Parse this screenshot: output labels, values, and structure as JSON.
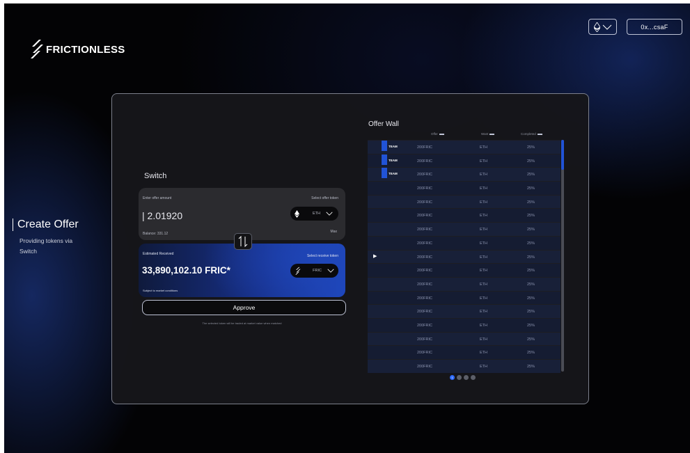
{
  "brand": {
    "name": "FRICTIONLESS"
  },
  "header": {
    "network_icon": "ethereum-icon",
    "wallet_address": "0x...csaF"
  },
  "sidebar": {
    "title": "Create Offer",
    "subtitle": "Providing tokens via Switch"
  },
  "switch": {
    "title": "Switch",
    "offer": {
      "label": "Enter offer amount",
      "select_label": "Select offer token",
      "amount": "| 2.01920",
      "balance": "Balance: 331.12",
      "max_label": "Max",
      "token": "ETH",
      "token_icon": "ethereum-icon"
    },
    "receive": {
      "label": "Estimated Received",
      "select_label": "Select receive token",
      "amount": "33,890,102.10 FRIC*",
      "note": "Subject to market conditions",
      "token": "FRIC",
      "token_icon": "frictionless-icon"
    },
    "approve_label": "Approve",
    "footnote": "The selected token will be traded at market value when matched"
  },
  "offer_wall": {
    "title": "Offer Wall",
    "columns": [
      "Offer",
      "Want",
      "Completed"
    ],
    "rows": [
      {
        "team": "TEAM",
        "offer": "200FRIC",
        "want": "ETH",
        "completed": "25%"
      },
      {
        "team": "TEAM",
        "offer": "200FRIC",
        "want": "ETH",
        "completed": "25%"
      },
      {
        "team": "TEAM",
        "offer": "200FRIC",
        "want": "ETH",
        "completed": "25%"
      },
      {
        "team": "",
        "offer": "200FRIC",
        "want": "ETH",
        "completed": "25%"
      },
      {
        "team": "",
        "offer": "200FRIC",
        "want": "ETH",
        "completed": "25%"
      },
      {
        "team": "",
        "offer": "200FRIC",
        "want": "ETH",
        "completed": "25%"
      },
      {
        "team": "",
        "offer": "200FRIC",
        "want": "ETH",
        "completed": "25%"
      },
      {
        "team": "",
        "offer": "200FRIC",
        "want": "ETH",
        "completed": "25%"
      },
      {
        "team": "",
        "offer": "200FRIC",
        "want": "ETH",
        "completed": "25%",
        "selected": true
      },
      {
        "team": "",
        "offer": "200FRIC",
        "want": "ETH",
        "completed": "25%"
      },
      {
        "team": "",
        "offer": "200FRIC",
        "want": "ETH",
        "completed": "25%"
      },
      {
        "team": "",
        "offer": "200FRIC",
        "want": "ETH",
        "completed": "25%"
      },
      {
        "team": "",
        "offer": "200FRIC",
        "want": "ETH",
        "completed": "25%"
      },
      {
        "team": "",
        "offer": "200FRIC",
        "want": "ETH",
        "completed": "25%"
      },
      {
        "team": "",
        "offer": "200FRIC",
        "want": "ETH",
        "completed": "25%"
      },
      {
        "team": "",
        "offer": "200FRIC",
        "want": "ETH",
        "completed": "25%"
      },
      {
        "team": "",
        "offer": "200FRIC",
        "want": "ETH",
        "completed": "25%"
      }
    ],
    "pagination": {
      "current": "1",
      "pages": 4
    }
  },
  "colors": {
    "accent": "#2153d6",
    "background": "#030305",
    "panel": "#16161a"
  }
}
